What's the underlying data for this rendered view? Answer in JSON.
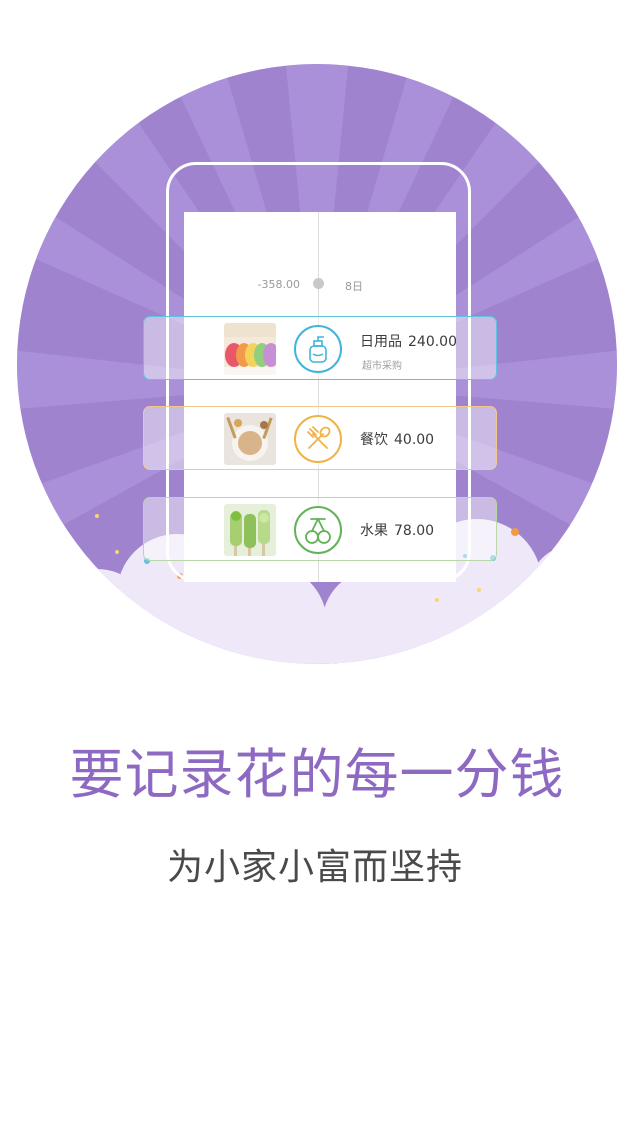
{
  "timeline": {
    "day_total": "-358.00",
    "day_label": "8日"
  },
  "entries": [
    {
      "category": "日用品",
      "amount": "240.00",
      "note": "超市采购",
      "icon": "lotion-bottle-icon",
      "color": "#3fb5d8"
    },
    {
      "category": "餐饮",
      "amount": "40.00",
      "icon": "fork-spoon-icon",
      "color": "#f0b346"
    },
    {
      "category": "水果",
      "amount": "78.00",
      "icon": "cherry-icon",
      "color": "#62b257"
    }
  ],
  "headline": "要记录花的每一分钱",
  "subline": "为小家小富而坚持",
  "colors": {
    "circle": "#9f83cf",
    "headline": "#8d69c2",
    "cloud": "#efe8f8"
  }
}
